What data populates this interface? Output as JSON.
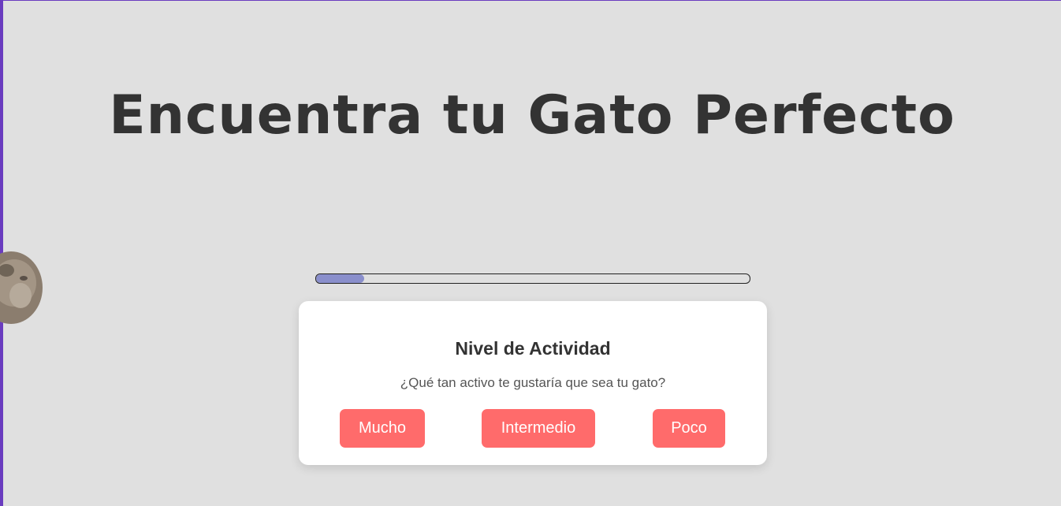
{
  "header": {
    "title": "Encuentra tu Gato Perfecto"
  },
  "progress": {
    "fraction": 0.11,
    "fill_color": "#8a8fcc"
  },
  "question": {
    "title": "Nivel de Actividad",
    "text": "¿Qué tan activo te gustaría que sea tu gato?",
    "options": [
      "Mucho",
      "Intermedio",
      "Poco"
    ]
  },
  "decor": {
    "image": "cat-image"
  },
  "colors": {
    "background": "#e0e0e0",
    "accent": "#ff6b6b",
    "frame": "#6a3cbf",
    "title_text": "#333333"
  }
}
